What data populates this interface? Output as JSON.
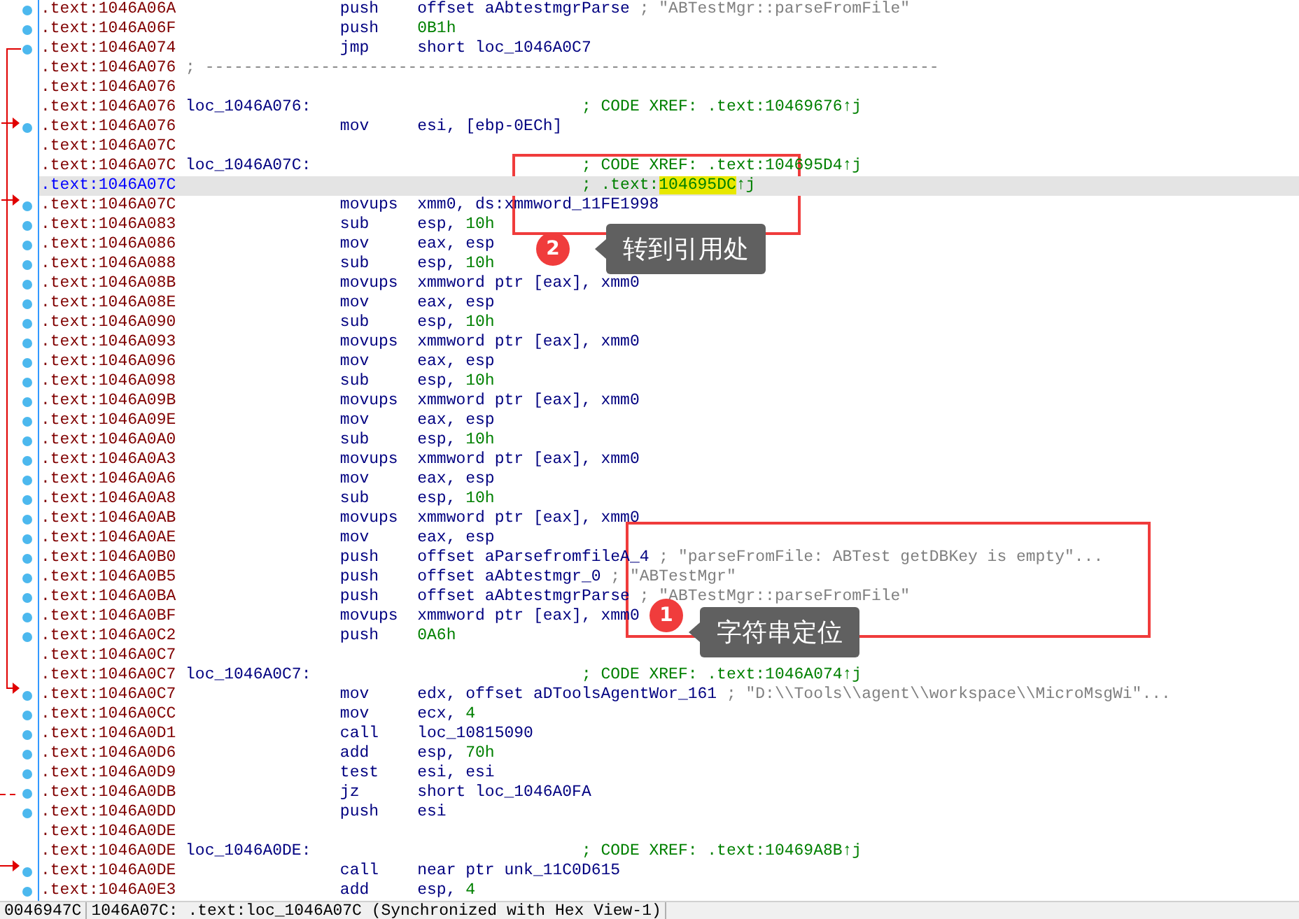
{
  "rows": [
    {
      "address": ".text:1046A06A",
      "kind": "instr",
      "selected": false,
      "mnemonic": "push",
      "operands": "offset aAbtestmgrParse",
      "comment": "; \"ABTestMgr::parseFromFile\""
    },
    {
      "address": ".text:1046A06F",
      "kind": "instr",
      "selected": false,
      "mnemonic": "push",
      "immediate": "0B1h"
    },
    {
      "address": ".text:1046A074",
      "kind": "instr",
      "selected": false,
      "mnemonic": "jmp",
      "operands": "short loc_1046A0C7"
    },
    {
      "address": ".text:1046A076",
      "kind": "separator",
      "selected": false,
      "text": "; ----------------------------------------------------------------------------"
    },
    {
      "address": ".text:1046A076",
      "kind": "blank",
      "selected": false
    },
    {
      "address": ".text:1046A076",
      "kind": "label",
      "selected": false,
      "label": "loc_1046A076:",
      "xref": "; CODE XREF: .text:10469676↑j"
    },
    {
      "address": ".text:1046A076",
      "kind": "instr",
      "selected": false,
      "mnemonic": "mov",
      "operands": "esi, [ebp-0ECh]"
    },
    {
      "address": ".text:1046A07C",
      "kind": "blank",
      "selected": false
    },
    {
      "address": ".text:1046A07C",
      "kind": "label",
      "selected": false,
      "label": "loc_1046A07C:",
      "xref": "; CODE XREF: .text:104695D4↑j"
    },
    {
      "address": ".text:1046A07C",
      "kind": "xref",
      "selected": true,
      "xref_prefix": "; .text:",
      "highlight": "104695DC",
      "xref_suffix": "↑j"
    },
    {
      "address": ".text:1046A07C",
      "kind": "instr",
      "selected": false,
      "mnemonic": "movups",
      "operands": "xmm0, ds:xmmword_11FE1998"
    },
    {
      "address": ".text:1046A083",
      "kind": "instr",
      "selected": false,
      "mnemonic": "sub",
      "operands": "esp,",
      "immediate": "10h"
    },
    {
      "address": ".text:1046A086",
      "kind": "instr",
      "selected": false,
      "mnemonic": "mov",
      "operands": "eax, esp"
    },
    {
      "address": ".text:1046A088",
      "kind": "instr",
      "selected": false,
      "mnemonic": "sub",
      "operands": "esp,",
      "immediate": "10h"
    },
    {
      "address": ".text:1046A08B",
      "kind": "instr",
      "selected": false,
      "mnemonic": "movups",
      "operands": "xmmword ptr [eax], xmm0"
    },
    {
      "address": ".text:1046A08E",
      "kind": "instr",
      "selected": false,
      "mnemonic": "mov",
      "operands": "eax, esp"
    },
    {
      "address": ".text:1046A090",
      "kind": "instr",
      "selected": false,
      "mnemonic": "sub",
      "operands": "esp,",
      "immediate": "10h"
    },
    {
      "address": ".text:1046A093",
      "kind": "instr",
      "selected": false,
      "mnemonic": "movups",
      "operands": "xmmword ptr [eax], xmm0"
    },
    {
      "address": ".text:1046A096",
      "kind": "instr",
      "selected": false,
      "mnemonic": "mov",
      "operands": "eax, esp"
    },
    {
      "address": ".text:1046A098",
      "kind": "instr",
      "selected": false,
      "mnemonic": "sub",
      "operands": "esp,",
      "immediate": "10h"
    },
    {
      "address": ".text:1046A09B",
      "kind": "instr",
      "selected": false,
      "mnemonic": "movups",
      "operands": "xmmword ptr [eax], xmm0"
    },
    {
      "address": ".text:1046A09E",
      "kind": "instr",
      "selected": false,
      "mnemonic": "mov",
      "operands": "eax, esp"
    },
    {
      "address": ".text:1046A0A0",
      "kind": "instr",
      "selected": false,
      "mnemonic": "sub",
      "operands": "esp,",
      "immediate": "10h"
    },
    {
      "address": ".text:1046A0A3",
      "kind": "instr",
      "selected": false,
      "mnemonic": "movups",
      "operands": "xmmword ptr [eax], xmm0"
    },
    {
      "address": ".text:1046A0A6",
      "kind": "instr",
      "selected": false,
      "mnemonic": "mov",
      "operands": "eax, esp"
    },
    {
      "address": ".text:1046A0A8",
      "kind": "instr",
      "selected": false,
      "mnemonic": "sub",
      "operands": "esp,",
      "immediate": "10h"
    },
    {
      "address": ".text:1046A0AB",
      "kind": "instr",
      "selected": false,
      "mnemonic": "movups",
      "operands": "xmmword ptr [eax], xmm0"
    },
    {
      "address": ".text:1046A0AE",
      "kind": "instr",
      "selected": false,
      "mnemonic": "mov",
      "operands": "eax, esp"
    },
    {
      "address": ".text:1046A0B0",
      "kind": "instr",
      "selected": false,
      "mnemonic": "push",
      "operands": "offset aParsefromfileA_4",
      "comment": "; \"parseFromFile: ABTest getDBKey is empty\"..."
    },
    {
      "address": ".text:1046A0B5",
      "kind": "instr",
      "selected": false,
      "mnemonic": "push",
      "operands": "offset aAbtestmgr_0",
      "comment": "; \"ABTestMgr\""
    },
    {
      "address": ".text:1046A0BA",
      "kind": "instr",
      "selected": false,
      "mnemonic": "push",
      "operands": "offset aAbtestmgrParse",
      "comment": "; \"ABTestMgr::parseFromFile\""
    },
    {
      "address": ".text:1046A0BF",
      "kind": "instr",
      "selected": false,
      "mnemonic": "movups",
      "operands": "xmmword ptr [eax], xmm0"
    },
    {
      "address": ".text:1046A0C2",
      "kind": "instr",
      "selected": false,
      "mnemonic": "push",
      "immediate": "0A6h"
    },
    {
      "address": ".text:1046A0C7",
      "kind": "blank",
      "selected": false
    },
    {
      "address": ".text:1046A0C7",
      "kind": "label",
      "selected": false,
      "label": "loc_1046A0C7:",
      "xref": "; CODE XREF: .text:1046A074↑j"
    },
    {
      "address": ".text:1046A0C7",
      "kind": "instr",
      "selected": false,
      "mnemonic": "mov",
      "operands": "edx, offset aDToolsAgentWor_161",
      "comment": "; \"D:\\\\Tools\\\\agent\\\\workspace\\\\MicroMsgWi\"..."
    },
    {
      "address": ".text:1046A0CC",
      "kind": "instr",
      "selected": false,
      "mnemonic": "mov",
      "operands": "ecx,",
      "immediate": "4"
    },
    {
      "address": ".text:1046A0D1",
      "kind": "instr",
      "selected": false,
      "mnemonic": "call",
      "operands": "loc_10815090"
    },
    {
      "address": ".text:1046A0D6",
      "kind": "instr",
      "selected": false,
      "mnemonic": "add",
      "operands": "esp,",
      "immediate": "70h"
    },
    {
      "address": ".text:1046A0D9",
      "kind": "instr",
      "selected": false,
      "mnemonic": "test",
      "operands": "esi, esi"
    },
    {
      "address": ".text:1046A0DB",
      "kind": "instr",
      "selected": false,
      "mnemonic": "jz",
      "operands": "short loc_1046A0FA"
    },
    {
      "address": ".text:1046A0DD",
      "kind": "instr",
      "selected": false,
      "mnemonic": "push",
      "operands": "esi"
    },
    {
      "address": ".text:1046A0DE",
      "kind": "blank",
      "selected": false
    },
    {
      "address": ".text:1046A0DE",
      "kind": "label",
      "selected": false,
      "label": "loc_1046A0DE:",
      "xref": "; CODE XREF: .text:10469A8B↑j"
    },
    {
      "address": ".text:1046A0DE",
      "kind": "instr",
      "selected": false,
      "mnemonic": "call",
      "operands": "near ptr unk_11C0D615"
    },
    {
      "address": ".text:1046A0E3",
      "kind": "instr",
      "selected": false,
      "mnemonic": "add",
      "operands": "esp,",
      "immediate": "4"
    }
  ],
  "status_bar": [
    "0046947C",
    "1046A07C: .text:loc_1046A07C (Synchronized with Hex View-1)"
  ],
  "annotations": [
    {
      "number": "2",
      "label": "转到引用处"
    },
    {
      "number": "1",
      "label": "字符串定位"
    }
  ]
}
